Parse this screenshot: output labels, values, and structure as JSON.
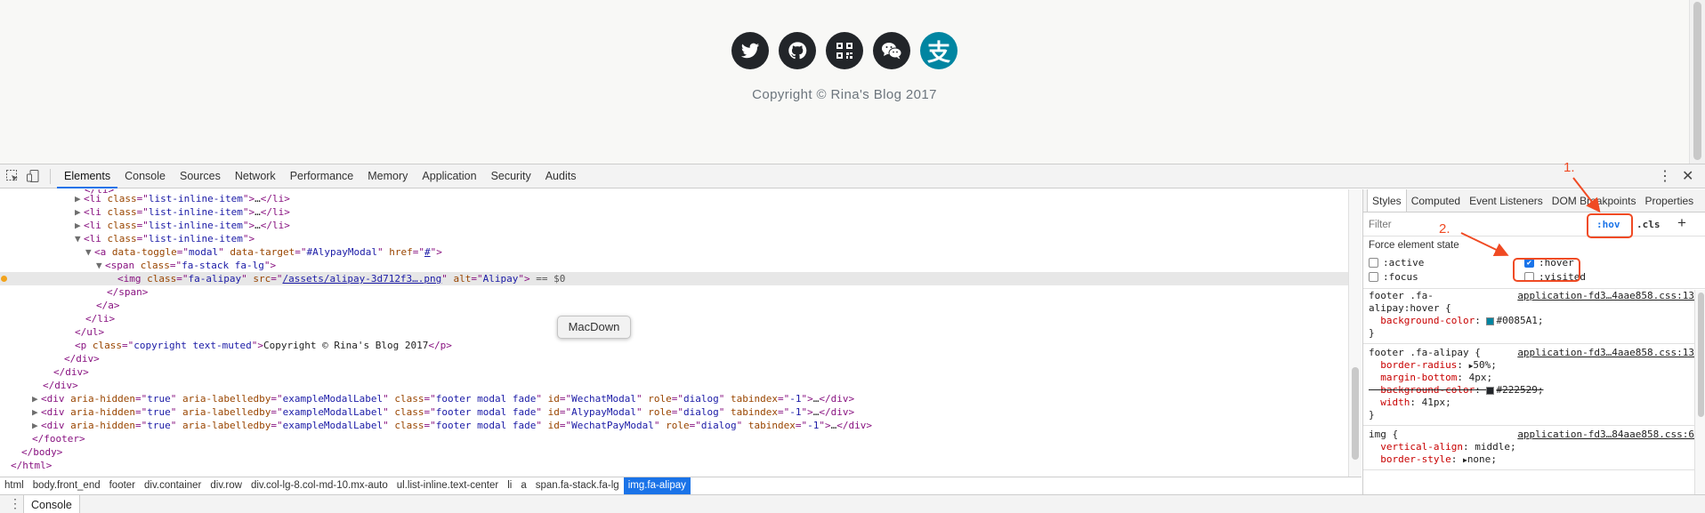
{
  "preview": {
    "social_icons": [
      "twitter-icon",
      "github-icon",
      "qrcode-icon",
      "wechat-icon",
      "alipay-icon"
    ],
    "alipay_glyph": "支",
    "copyright": "Copyright © Rina's Blog 2017"
  },
  "devtools": {
    "tabs": [
      "Elements",
      "Console",
      "Sources",
      "Network",
      "Performance",
      "Memory",
      "Application",
      "Security",
      "Audits"
    ],
    "active_tab": "Elements",
    "more_icon": "⋮",
    "close_icon": "✕"
  },
  "dom": {
    "l1_cls": "list-inline-item",
    "l1_tail": ">…</",
    "ellipsis": "…",
    "li": "li",
    "a_tag": "a",
    "a_attr1": "data-toggle",
    "a_val1": "modal",
    "a_attr2": "data-target",
    "a_val2": "#AlypayModal",
    "a_attr3": "href",
    "a_val3": "#",
    "span_tag": "span",
    "span_cls": "fa-stack fa-lg",
    "img_tag": "img",
    "img_cls": "fa-alipay",
    "img_src": "/assets/alipay-3d712f3….png",
    "img_alt": "Alipay",
    "eq0": " == $0",
    "ul": "ul",
    "p_tag": "p",
    "p_cls": "copyright text-muted",
    "p_text": "Copyright © Rina's Blog 2017",
    "div": "div",
    "footer": "footer",
    "body": "body",
    "html": "html",
    "class_attr": "class",
    "src_attr": "src",
    "alt_attr": "alt",
    "modals": [
      {
        "id": "WechatModal"
      },
      {
        "id": "AlypayModal"
      },
      {
        "id": "WechatPayModal"
      }
    ],
    "modal_attrs": {
      "aria_hidden": "aria-hidden",
      "aria_hidden_val": "true",
      "labelledby": "aria-labelledby",
      "labelledby_val": "exampleModalLabel",
      "cls_val": "footer modal fade",
      "id_attr": "id",
      "role": "role",
      "role_val": "dialog",
      "tabindex": "tabindex",
      "tabindex_val": "-1"
    }
  },
  "breadcrumbs": [
    "html",
    "body.front_end",
    "footer",
    "div.container",
    "div.row",
    "div.col-lg-8.col-md-10.mx-auto",
    "ul.list-inline.text-center",
    "li",
    "a",
    "span.fa-stack.fa-lg",
    "img.fa-alipay"
  ],
  "active_crumb": "img.fa-alipay",
  "tooltip": "MacDown",
  "drawer": {
    "tab": "Console"
  },
  "styles_pane": {
    "tabs": [
      "Styles",
      "Computed",
      "Event Listeners",
      "DOM Breakpoints",
      "Properties"
    ],
    "filter_placeholder": "Filter",
    "hov": ":hov",
    "cls": ".cls",
    "plus": "+",
    "force_title": "Force element state",
    "states": [
      {
        "label": ":active",
        "checked": false
      },
      {
        "label": ":hover",
        "checked": true
      },
      {
        "label": ":focus",
        "checked": false
      },
      {
        "label": ":visited",
        "checked": false
      }
    ],
    "rules": [
      {
        "selector_lines": [
          "footer .fa-",
          "alipay:hover {"
        ],
        "source": "application-fd3…4aae858.css:13",
        "decls": [
          {
            "prop": "background-color",
            "value": "#0085A1",
            "swatch": "#0085A1",
            "struck": false
          }
        ]
      },
      {
        "selector_lines": [
          "footer .fa-alipay {"
        ],
        "source": "application-fd3…4aae858.css:13",
        "decls": [
          {
            "prop": "border-radius",
            "value": "50%",
            "arrow": true,
            "struck": false
          },
          {
            "prop": "margin-bottom",
            "value": "4px",
            "struck": false
          },
          {
            "prop": "background-color",
            "value": "#222529",
            "swatch": "#222529",
            "struck": true
          },
          {
            "prop": "width",
            "value": "41px",
            "struck": false
          }
        ]
      },
      {
        "selector_lines": [
          "img {"
        ],
        "source": "application-fd3…84aae858.css:6",
        "decls": [
          {
            "prop": "vertical-align",
            "value": "middle",
            "struck": false
          },
          {
            "prop": "border-style",
            "value": "none",
            "arrow": true,
            "struck": false
          }
        ]
      }
    ]
  },
  "annotations": [
    "1.",
    "2."
  ],
  "colors": {
    "accent": "#1a73e8",
    "alipay": "#0085A1",
    "icon_dark": "#222529",
    "annotation": "#f04a23"
  }
}
